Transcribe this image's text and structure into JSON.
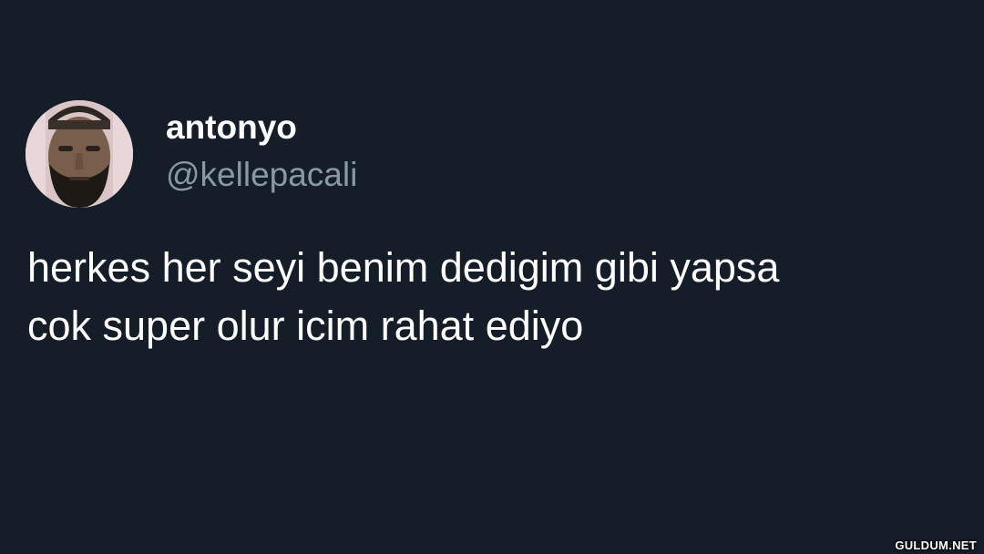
{
  "author": {
    "display_name": "antonyo",
    "handle": "@kellepacali",
    "avatar_icon": "profile-photo-icon"
  },
  "tweet": {
    "lines": [
      "herkes her seyi benim dedigim gibi yapsa",
      "cok super olur icim rahat ediyo"
    ]
  },
  "watermark": "GULDUM.NET",
  "colors": {
    "background": "#151d29",
    "primary_text": "#ffffff",
    "secondary_text": "#8899a6"
  }
}
